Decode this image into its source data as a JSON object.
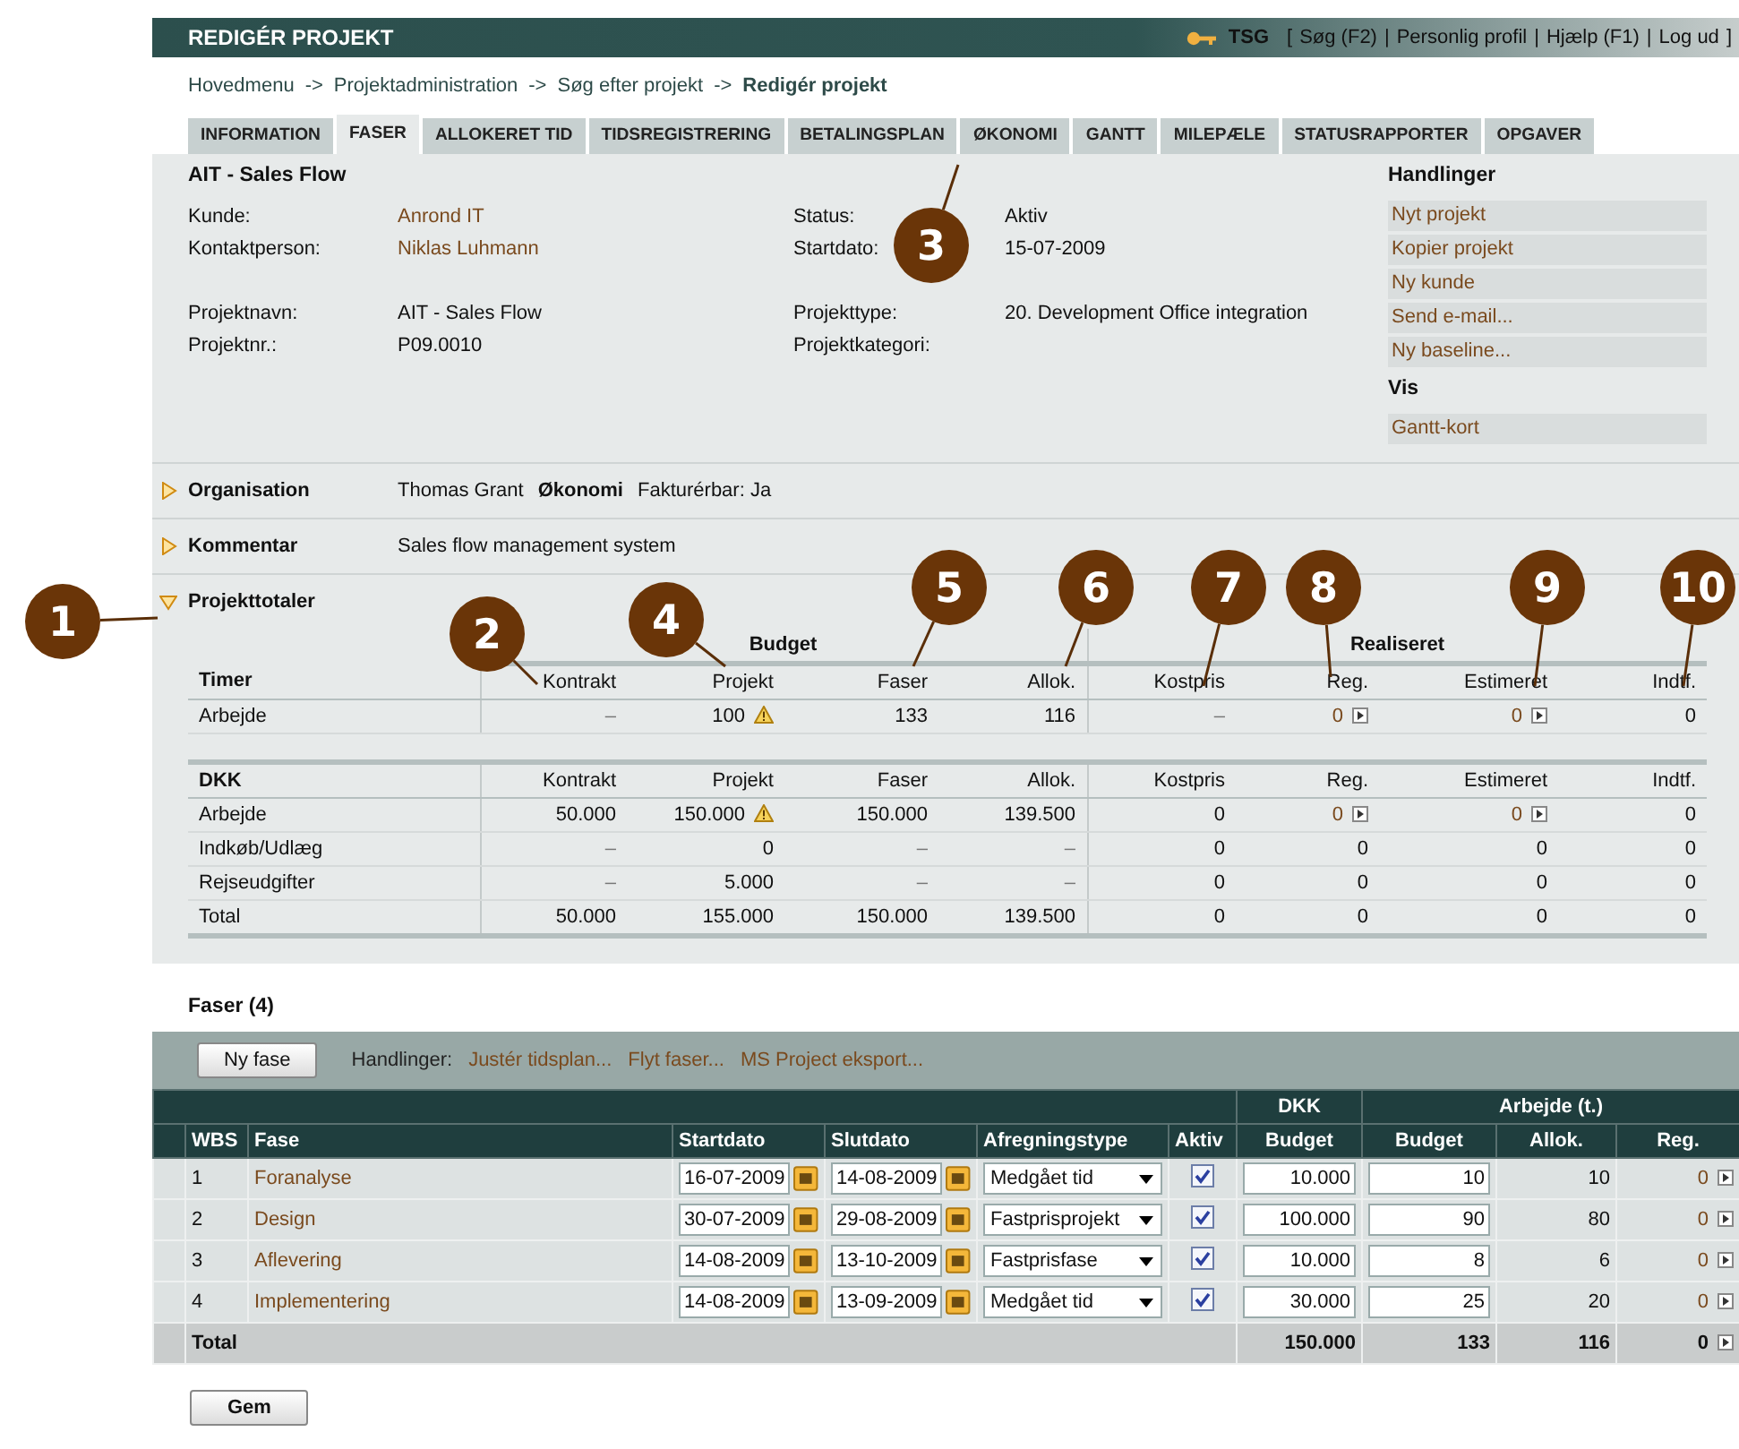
{
  "header": {
    "title": "REDIGÉR PROJEKT",
    "user": "TSG",
    "bracket_open": "[",
    "links": [
      "Søg (F2)",
      "Personlig profil",
      "Hjælp (F1)",
      "Log ud"
    ],
    "separators": [
      "|",
      "|",
      "|"
    ],
    "bracket_close": "]"
  },
  "breadcrumb": {
    "items": [
      {
        "label": "Hovedmenu",
        "current": false
      },
      {
        "label": "Projektadministration",
        "current": false
      },
      {
        "label": "Søg efter projekt",
        "current": false
      },
      {
        "label": "Redigér projekt",
        "current": true
      }
    ],
    "arrows": [
      "->",
      "->",
      "->"
    ]
  },
  "tabs": [
    {
      "label": "INFORMATION",
      "selected": false
    },
    {
      "label": "FASER",
      "selected": true
    },
    {
      "label": "ALLOKERET TID",
      "selected": false
    },
    {
      "label": "TIDSREGISTRERING",
      "selected": false
    },
    {
      "label": "BETALINGSPLAN",
      "selected": false
    },
    {
      "label": "ØKONOMI",
      "selected": false
    },
    {
      "label": "GANTT",
      "selected": false
    },
    {
      "label": "MILEPÆLE",
      "selected": false
    },
    {
      "label": "STATUSRAPPORTER",
      "selected": false
    },
    {
      "label": "OPGAVER",
      "selected": false
    }
  ],
  "info": {
    "title": "AIT - Sales Flow",
    "left_groups": [
      [
        {
          "label": "Kunde:",
          "value": "Anrond IT",
          "link": true
        },
        {
          "label": "Kontaktperson:",
          "value": "Niklas Luhmann",
          "link": true
        }
      ],
      [
        {
          "label": "Projektnavn:",
          "value": "AIT - Sales Flow",
          "link": false
        },
        {
          "label": "Projektnr.:",
          "value": "P09.0010",
          "link": false
        }
      ]
    ],
    "right_groups": [
      [
        {
          "label": "Status:",
          "value": "Aktiv",
          "link": false
        },
        {
          "label": "Startdato:",
          "value": "15-07-2009",
          "link": false
        }
      ],
      [
        {
          "label": "Projekttype:",
          "value": "20. Development Office integration",
          "link": false
        },
        {
          "label": "Projektkategori:"
        }
      ]
    ],
    "side": [
      {
        "heading": "Handlinger",
        "items": [
          "Nyt projekt",
          "Kopier projekt",
          "Ny kunde",
          "Send e-mail...",
          "Ny baseline..."
        ]
      },
      {
        "heading": "Vis",
        "items": [
          "Gantt-kort"
        ]
      }
    ]
  },
  "sections": [
    {
      "title": "Organisation",
      "expanded": false,
      "values": [
        {
          "text": "Thomas Grant",
          "bold": false
        },
        {
          "text": "Økonomi",
          "bold": true
        },
        {
          "text": "Fakturérbar: Ja",
          "bold": false
        }
      ]
    },
    {
      "title": "Kommentar",
      "expanded": false,
      "values": [
        {
          "text": "Sales flow management system",
          "bold": false
        }
      ]
    },
    {
      "title": "Projekttotaler",
      "expanded": true
    }
  ],
  "totals": {
    "groups": [
      {
        "label": "Budget"
      },
      {
        "label": "Realiseret"
      }
    ],
    "tables": [
      {
        "header": [
          "Timer",
          "Kontrakt",
          "Projekt",
          "Faser",
          "Allok.",
          "Kostpris",
          "Reg.",
          "Estimeret",
          "Indtf."
        ],
        "rows": [
          {
            "kind": "normal",
            "warning": true,
            "drill": true,
            "cells": [
              "Arbejde",
              "–",
              "100",
              "133",
              "116",
              "–",
              "0",
              "0",
              "0"
            ]
          }
        ]
      },
      {
        "header": [
          "DKK",
          "Kontrakt",
          "Projekt",
          "Faser",
          "Allok.",
          "Kostpris",
          "Reg.",
          "Estimeret",
          "Indtf."
        ],
        "rows": [
          {
            "kind": "normal",
            "warning": true,
            "drill": true,
            "cells": [
              "Arbejde",
              "50.000",
              "150.000",
              "150.000",
              "139.500",
              "0",
              "0",
              "0",
              "0"
            ]
          },
          {
            "kind": "normal",
            "warning": false,
            "drill": false,
            "cells": [
              "Indkøb/Udlæg",
              "–",
              "0",
              "–",
              "–",
              "0",
              "0",
              "0",
              "0"
            ]
          },
          {
            "kind": "normal",
            "warning": false,
            "drill": false,
            "cells": [
              "Rejseudgifter",
              "–",
              "5.000",
              "–",
              "–",
              "0",
              "0",
              "0",
              "0"
            ]
          },
          {
            "kind": "total",
            "warning": false,
            "drill": false,
            "cells": [
              "Total",
              "50.000",
              "155.000",
              "150.000",
              "139.500",
              "0",
              "0",
              "0",
              "0"
            ]
          }
        ]
      }
    ]
  },
  "phases": {
    "title": "Faser (4)",
    "new_button": "Ny fase",
    "actions_label": "Handlinger:",
    "actions": [
      "Justér tidsplan...",
      "Flyt faser...",
      "MS Project eksport..."
    ],
    "columns": [
      "WBS",
      "Fase",
      "Startdato",
      "Slutdato",
      "Afregningstype",
      "Aktiv"
    ],
    "column_groups": [
      {
        "label": "DKK",
        "columns": [
          "Budget"
        ]
      },
      {
        "label": "Arbejde (t.)",
        "columns": [
          "Budget",
          "Allok.",
          "Reg."
        ]
      }
    ],
    "rows": [
      {
        "wbs": "1",
        "name": "Foranalyse",
        "start": "16-07-2009",
        "end": "14-08-2009",
        "billing": "Medgået tid",
        "active": true,
        "dkk_budget": "10.000",
        "hours_budget": "10",
        "allok": "10",
        "reg": "0"
      },
      {
        "wbs": "2",
        "name": "Design",
        "start": "30-07-2009",
        "end": "29-08-2009",
        "billing": "Fastprisprojekt",
        "active": true,
        "dkk_budget": "100.000",
        "hours_budget": "90",
        "allok": "80",
        "reg": "0"
      },
      {
        "wbs": "3",
        "name": "Aflevering",
        "start": "14-08-2009",
        "end": "13-10-2009",
        "billing": "Fastprisfase",
        "active": true,
        "dkk_budget": "10.000",
        "hours_budget": "8",
        "allok": "6",
        "reg": "0"
      },
      {
        "wbs": "4",
        "name": "Implementering",
        "start": "14-08-2009",
        "end": "13-09-2009",
        "billing": "Medgået tid",
        "active": true,
        "dkk_budget": "30.000",
        "hours_budget": "25",
        "allok": "20",
        "reg": "0"
      }
    ],
    "total": {
      "label": "Total",
      "dkk_budget": "150.000",
      "hours_budget": "133",
      "allok": "116",
      "reg": "0"
    },
    "save_button": "Gem"
  },
  "callouts": [
    "1",
    "2",
    "3",
    "4",
    "5",
    "6",
    "7",
    "8",
    "9",
    "10"
  ]
}
